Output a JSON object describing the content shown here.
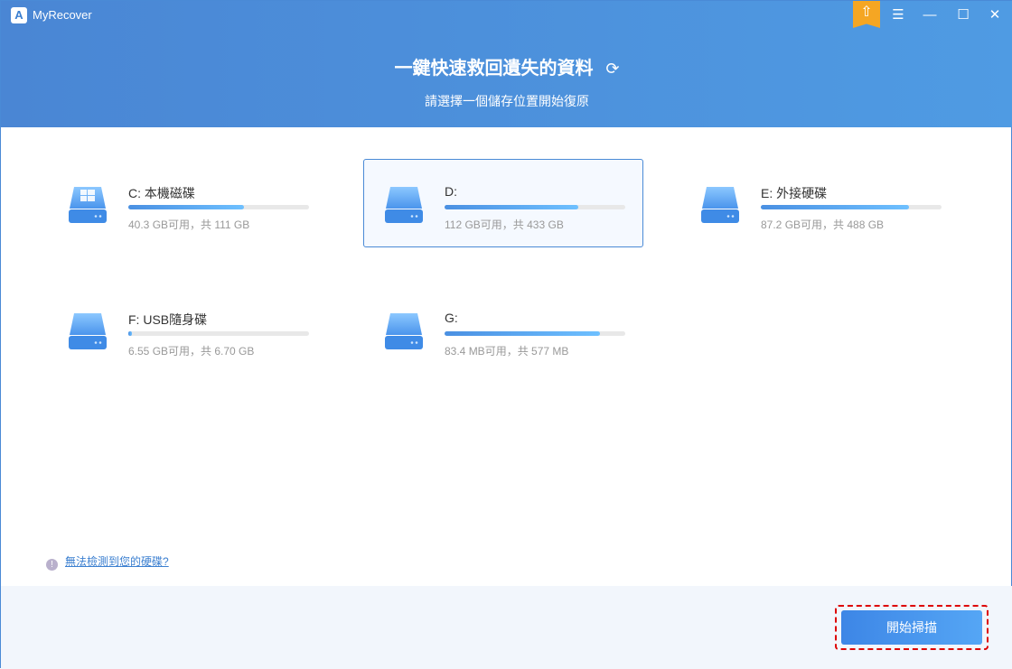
{
  "app": {
    "title": "MyRecover",
    "logo_letter": "A"
  },
  "window": {
    "upgrade": "⇧",
    "menu": "☰",
    "minimize": "—",
    "maximize": "☐",
    "close": "✕"
  },
  "header": {
    "title": "一鍵快速救回遺失的資料",
    "refresh": "⟳",
    "subtitle": "請選擇一個儲存位置開始復原"
  },
  "drives": [
    {
      "name": "C: 本機磁碟",
      "info": "40.3 GB可用，共 111 GB",
      "used_percent": 64,
      "system": true,
      "selected": false
    },
    {
      "name": "D:",
      "info": "112 GB可用，共 433 GB",
      "used_percent": 74,
      "system": false,
      "selected": true
    },
    {
      "name": "E: 外接硬碟",
      "info": "87.2 GB可用，共 488 GB",
      "used_percent": 82,
      "system": false,
      "selected": false
    },
    {
      "name": "F: USB隨身碟",
      "info": "6.55 GB可用，共 6.70 GB",
      "used_percent": 2,
      "system": false,
      "selected": false
    },
    {
      "name": "G:",
      "info": "83.4 MB可用，共 577 MB",
      "used_percent": 86,
      "system": false,
      "selected": false
    }
  ],
  "help": {
    "icon": "!",
    "link": "無法檢測到您的硬碟?"
  },
  "footer": {
    "scan_button": "開始掃描"
  }
}
